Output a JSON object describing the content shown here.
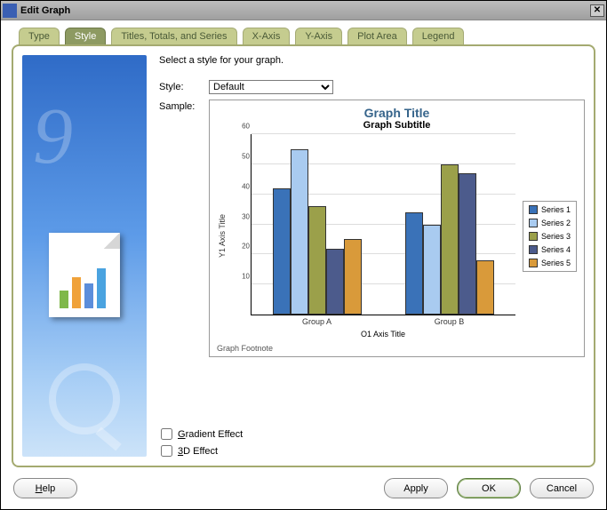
{
  "window": {
    "title": "Edit Graph"
  },
  "tabs": [
    {
      "label": "Type"
    },
    {
      "label": "Style"
    },
    {
      "label": "Titles, Totals, and Series"
    },
    {
      "label": "X-Axis"
    },
    {
      "label": "Y-Axis"
    },
    {
      "label": "Plot Area"
    },
    {
      "label": "Legend"
    }
  ],
  "active_tab": 1,
  "instruction": "Select a style for your graph.",
  "labels": {
    "style": "Style:",
    "sample": "Sample:",
    "gradient_prefix": "G",
    "gradient_rest": "radient Effect",
    "three_d_prefix": "3",
    "three_d_rest": "D Effect"
  },
  "style_select": {
    "value": "Default",
    "options": [
      "Default"
    ]
  },
  "checkboxes": {
    "gradient": false,
    "three_d": false
  },
  "buttons": {
    "help": "Help",
    "apply": "Apply",
    "ok": "OK",
    "cancel": "Cancel"
  },
  "chart_data": {
    "type": "bar",
    "title": "Graph Title",
    "subtitle": "Graph Subtitle",
    "xlabel": "O1 Axis Title",
    "ylabel": "Y1 Axis Title",
    "footnote": "Graph Footnote",
    "ylim": [
      0,
      60
    ],
    "yticks": [
      10,
      20,
      30,
      40,
      50,
      60
    ],
    "categories": [
      "Group A",
      "Group B"
    ],
    "series": [
      {
        "name": "Series 1",
        "color": "#3a72b8",
        "values": [
          42,
          34
        ]
      },
      {
        "name": "Series 2",
        "color": "#a9cbf0",
        "values": [
          55,
          30
        ]
      },
      {
        "name": "Series 3",
        "color": "#9ba04a",
        "values": [
          36,
          50
        ]
      },
      {
        "name": "Series 4",
        "color": "#4c5b8c",
        "values": [
          22,
          47
        ]
      },
      {
        "name": "Series 5",
        "color": "#d99a3a",
        "values": [
          25,
          18
        ]
      }
    ]
  }
}
